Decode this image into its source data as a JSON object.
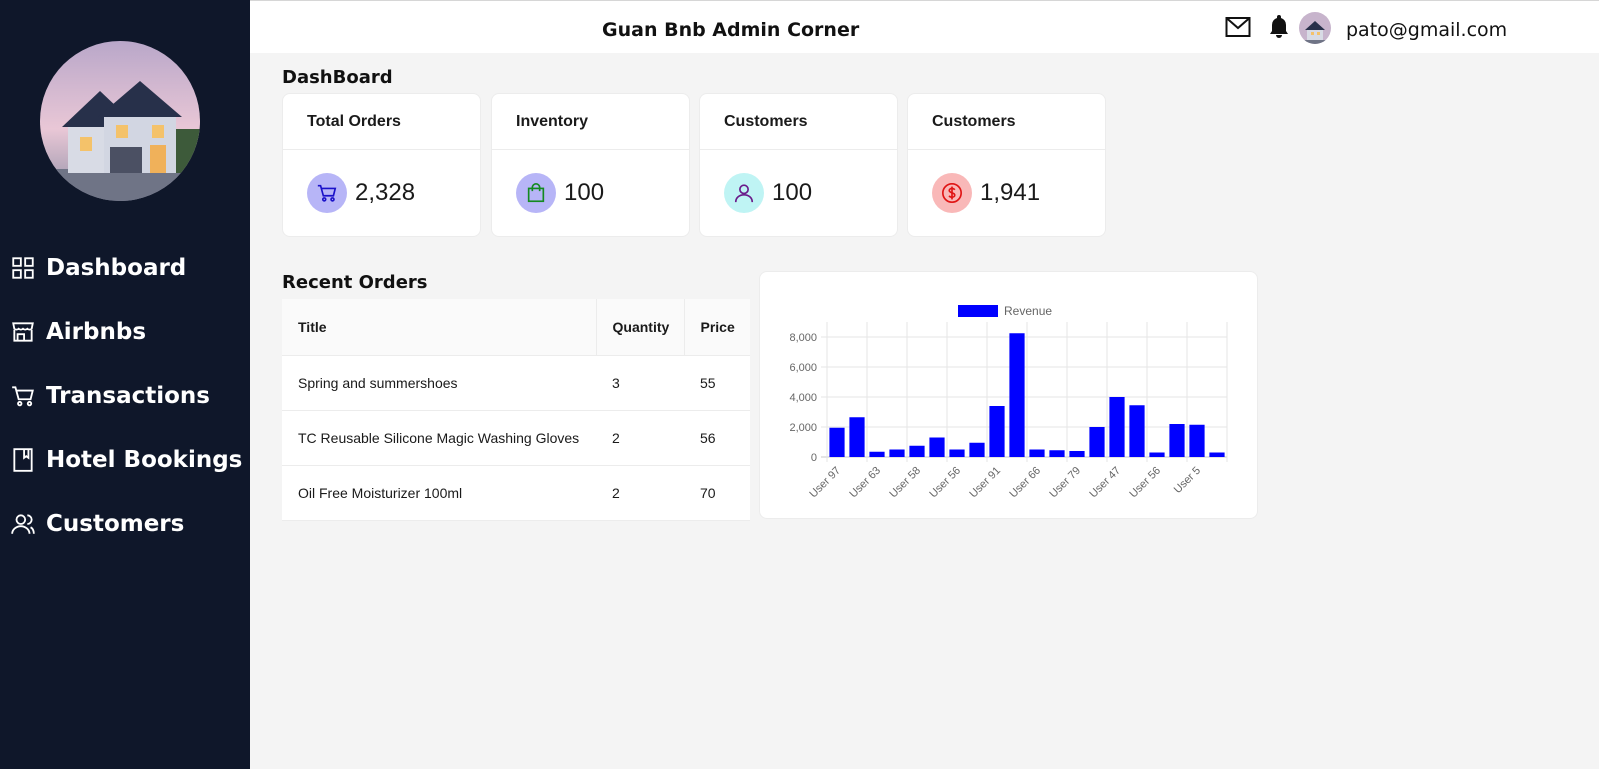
{
  "app": {
    "title": "Guan Bnb Admin Corner"
  },
  "user": {
    "email": "pato@gmail.com"
  },
  "header_icons": [
    "mail-icon",
    "bell-icon",
    "user-avatar"
  ],
  "sidebar": {
    "logo": "house-logo",
    "items": [
      {
        "label": "Dashboard",
        "icon": "grid-icon"
      },
      {
        "label": "Airbnbs",
        "icon": "store-icon"
      },
      {
        "label": "Transactions",
        "icon": "cart-icon"
      },
      {
        "label": "Hotel Bookings",
        "icon": "book-icon"
      },
      {
        "label": "Customers",
        "icon": "users-icon"
      }
    ]
  },
  "dashboard": {
    "title": "DashBoard",
    "cards": [
      {
        "title": "Total Orders",
        "value": "2,328",
        "icon": "cart-icon",
        "icon_bg": "#b7b5f7",
        "icon_color": "#1b12c9"
      },
      {
        "title": "Inventory",
        "value": "100",
        "icon": "shopping-bag-icon",
        "icon_bg": "#b7b5f7",
        "icon_color": "#138a20"
      },
      {
        "title": "Customers",
        "value": "100",
        "icon": "user-icon",
        "icon_bg": "#bff4f4",
        "icon_color": "#6a1b8a"
      },
      {
        "title": "Customers",
        "value": "1,941",
        "icon": "dollar-icon",
        "icon_bg": "#f9b8b8",
        "icon_color": "#e01414"
      }
    ]
  },
  "recent_orders": {
    "title": "Recent Orders",
    "columns": [
      "Title",
      "Quantity",
      "Price"
    ],
    "rows": [
      {
        "title": "Spring and summershoes",
        "quantity": "3",
        "price": "55"
      },
      {
        "title": "TC Reusable Silicone Magic Washing Gloves",
        "quantity": "2",
        "price": "56"
      },
      {
        "title": "Oil Free Moisturizer 100ml",
        "quantity": "2",
        "price": "70"
      }
    ]
  },
  "colors": {
    "sidebar_bg": "#0f172a",
    "page_bg": "#f4f4f4",
    "bar_color": "#0000ff"
  },
  "chart_data": {
    "type": "bar",
    "legend": "Revenue",
    "legend_position": "top",
    "grid": true,
    "x_tick_labels": [
      "User 97",
      "User 63",
      "User 58",
      "User 56",
      "User 91",
      "User 66",
      "User 79",
      "User 47",
      "User 56",
      "User 5"
    ],
    "values": [
      1950,
      2650,
      350,
      500,
      750,
      1300,
      500,
      950,
      3400,
      8250,
      500,
      450,
      400,
      2000,
      4000,
      3450,
      300,
      2200,
      2150,
      300
    ],
    "y_ticks": [
      "0",
      "2,000",
      "4,000",
      "6,000",
      "8,000"
    ],
    "ylim": [
      0,
      9000
    ]
  }
}
